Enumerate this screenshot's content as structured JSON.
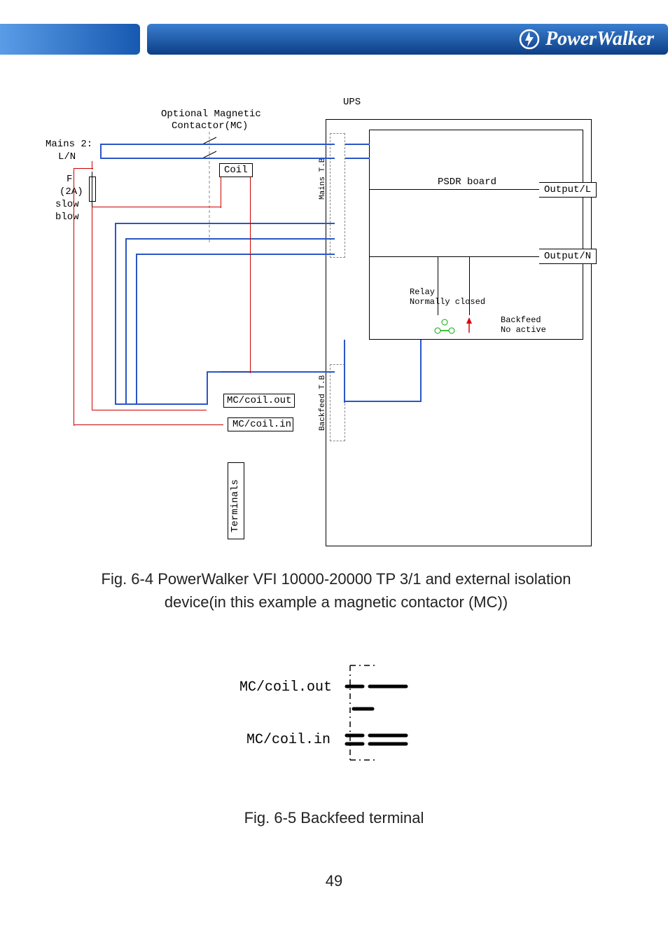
{
  "header": {
    "brand": "PowerWalker"
  },
  "diagram1": {
    "ups": "UPS",
    "optional_mc_line1": "Optional Magnetic",
    "optional_mc_line2": "Contactor(MC)",
    "mains_line1": "Mains 2:",
    "mains_line2": "L/N",
    "f": "F",
    "fuse_rating": "(2A)",
    "slow": "slow",
    "blow": "blow",
    "coil": "Coil",
    "mains_tb": "Mains T.B",
    "psdr": "PSDR board",
    "output_l": "Output/L",
    "output_n": "Output/N",
    "relay_line1": "Relay",
    "relay_line2": "Normally closed",
    "backfeed": "Backfeed",
    "no_active": "No active",
    "backfeed_tb": "Backfeed T.B",
    "mc_coil_out": "MC/coil.out",
    "mc_coil_in": "MC/coil.in",
    "terminals": "Terminals"
  },
  "diagram2": {
    "mc_coil_out": "MC/coil.out",
    "mc_coil_in": "MC/coil.in"
  },
  "caption1_line1": "Fig. 6-4 PowerWalker VFI 10000-20000 TP 3/1 and external isolation",
  "caption1_line2": "device(in this example a magnetic contactor (MC))",
  "caption2": "Fig. 6-5 Backfeed terminal",
  "page_number": "49"
}
